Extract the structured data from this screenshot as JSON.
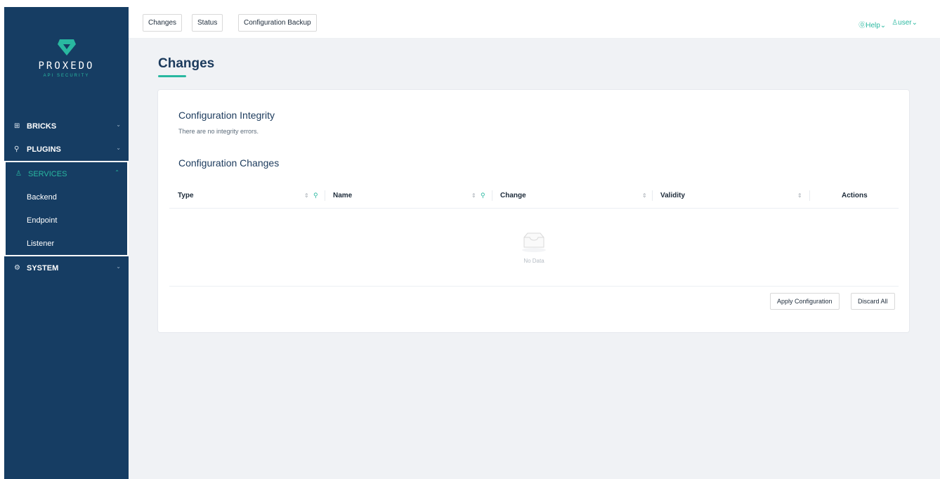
{
  "brand": {
    "name": "PROXEDO",
    "tagline": "API SECURITY",
    "accent_color": "#29b8a0",
    "sidebar_color": "#163d63"
  },
  "sidebar": {
    "items": [
      {
        "label": "BRICKS",
        "icon": "bricks-icon",
        "expanded": false
      },
      {
        "label": "PLUGINS",
        "icon": "plug-icon",
        "expanded": false
      },
      {
        "label": "SERVICES",
        "icon": "services-icon",
        "expanded": true,
        "children": [
          "Backend",
          "Endpoint",
          "Listener"
        ]
      },
      {
        "label": "SYSTEM",
        "icon": "gear-icon",
        "expanded": false
      }
    ]
  },
  "topbar": {
    "tabs": [
      "Changes",
      "Status",
      "Configuration Backup"
    ],
    "help_label": "Help",
    "user_label": "user"
  },
  "page": {
    "title": "Changes",
    "integrity_title": "Configuration Integrity",
    "integrity_text": "There are no integrity errors.",
    "changes_title": "Configuration Changes",
    "table": {
      "columns": [
        "Type",
        "Name",
        "Change",
        "Validity",
        "Actions"
      ],
      "rows": [],
      "empty_text": "No Data"
    },
    "apply_label": "Apply Configuration",
    "discard_label": "Discard All"
  }
}
